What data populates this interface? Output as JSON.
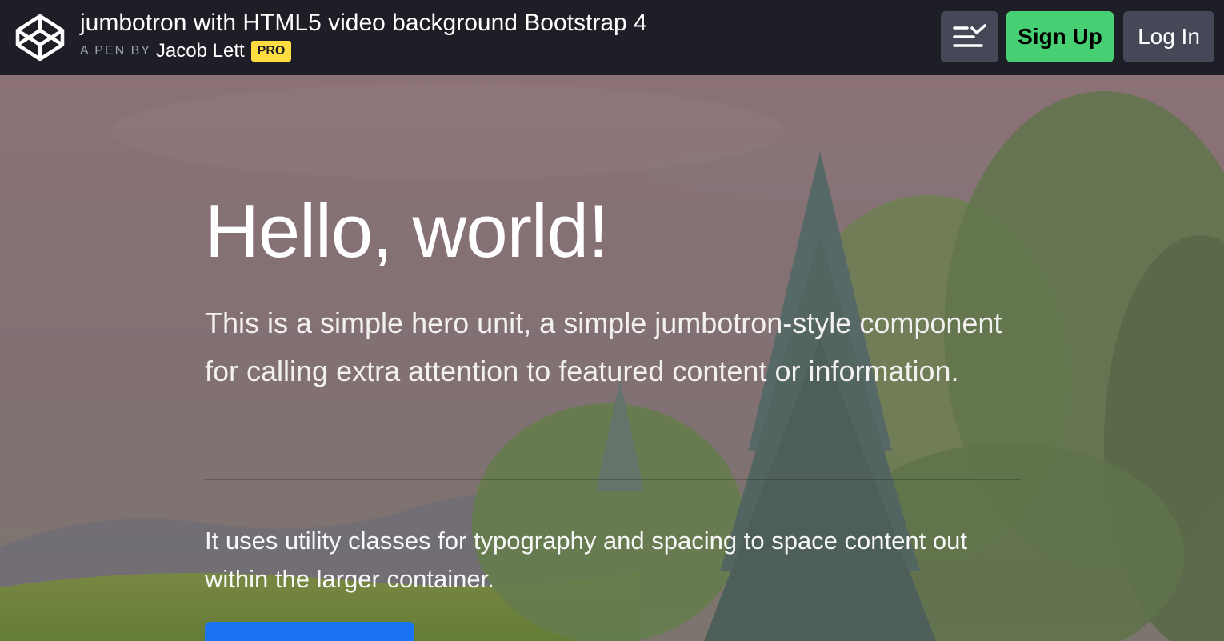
{
  "header": {
    "logo_icon": "codepen-logo-icon",
    "pen_title": "jumbotron with HTML5 video background Bootstrap 4",
    "byline_prefix": "A PEN BY",
    "author": "Jacob Lett",
    "badge": "PRO",
    "layout_icon": "layout-toggle-icon",
    "signup_label": "Sign Up",
    "login_label": "Log In"
  },
  "hero": {
    "heading": "Hello, world!",
    "lead": "This is a simple hero unit, a simple jumbotron-style component for calling extra attention to featured content or information.",
    "text": "It uses utility classes for typography and spacing to space content out within the larger container."
  },
  "colors": {
    "header_bg": "#1e1f26",
    "signup_green": "#47cf73",
    "button_gray": "#444857",
    "pro_yellow": "#ffdd40",
    "cta_blue": "#1a73f0"
  }
}
